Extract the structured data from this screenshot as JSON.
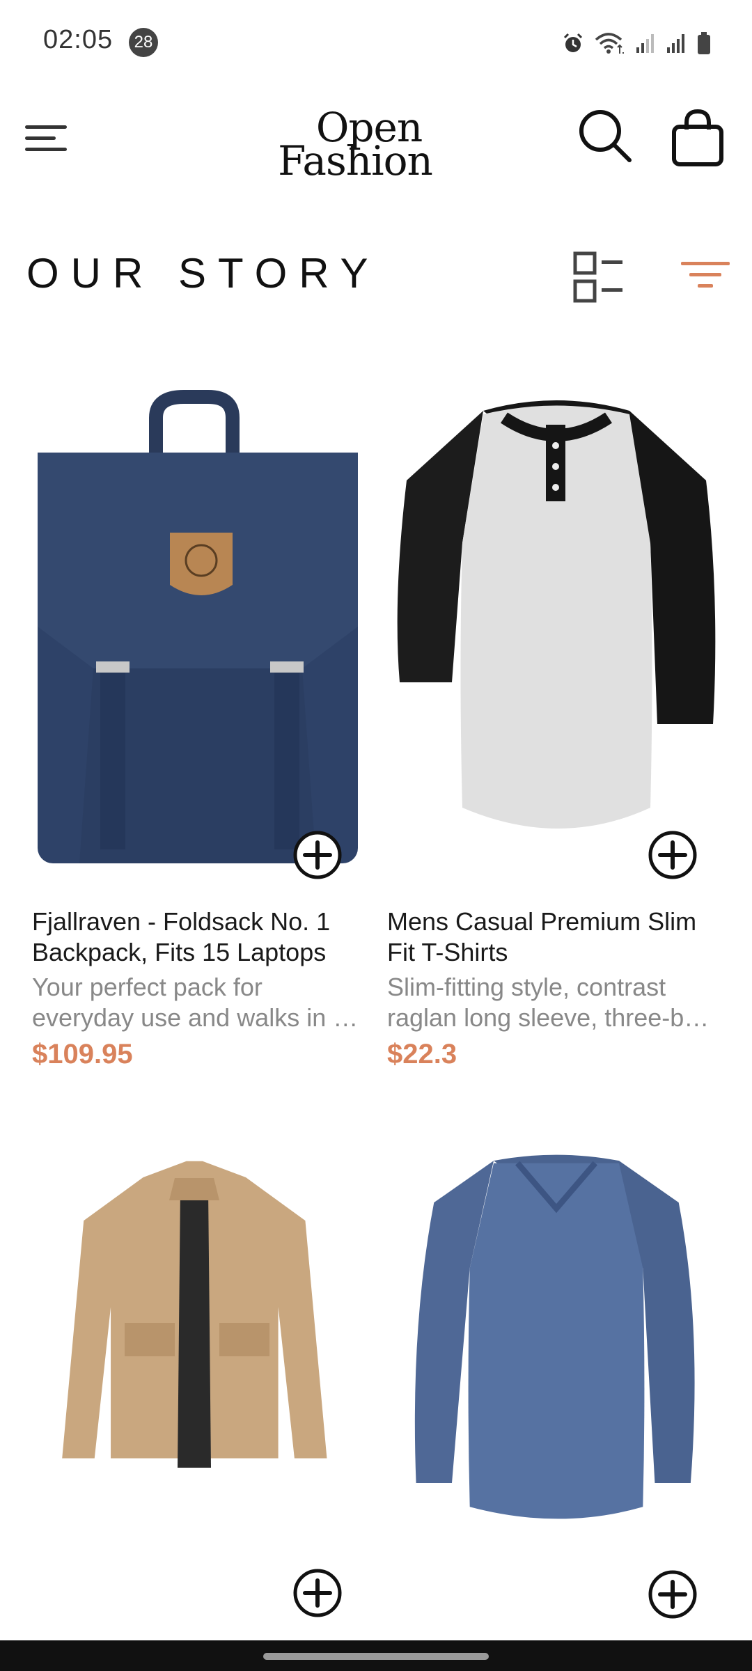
{
  "status_bar": {
    "time": "02:05",
    "notification_count": "28",
    "icons": [
      "alarm-icon",
      "wifi-icon",
      "signal-icon",
      "signal-icon",
      "battery-icon"
    ]
  },
  "header": {
    "logo_line1": "Open",
    "logo_line2": "Fashion",
    "icons": [
      "menu-icon",
      "search-icon",
      "shopping-bag-icon"
    ]
  },
  "section": {
    "title": "OUR STORY",
    "accent_color": "#d9825b"
  },
  "products": [
    {
      "name": "Fjallraven - Foldsack No. 1 Backpack, Fits 15 Laptops",
      "description": "Your perfect pack for everyday use and walks in …",
      "price": "$109.95",
      "image": "navy-backpack"
    },
    {
      "name": "Mens Casual Premium Slim Fit T-Shirts",
      "description": "Slim-fitting style, contrast raglan long sleeve, three-b…",
      "price": "$22.3",
      "image": "raglan-henley-shirt"
    },
    {
      "name": "",
      "description": "",
      "price": "",
      "image": "khaki-jacket"
    },
    {
      "name": "",
      "description": "",
      "price": "",
      "image": "blue-long-sleeve-shirt"
    }
  ]
}
